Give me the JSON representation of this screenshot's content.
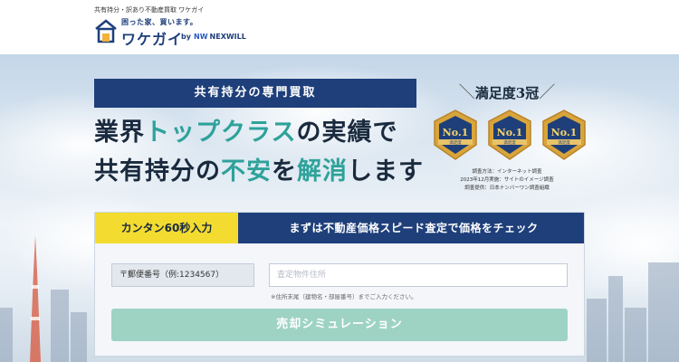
{
  "header": {
    "tagline": "共有持分・訳あり不動産買取 ワケガイ",
    "logo": {
      "catch": "困った家、買います。",
      "name": "ワケガイ",
      "by": "by",
      "partner": "NEXWILL",
      "partner_mark": "NW"
    }
  },
  "hero": {
    "badge": "共有持分の専門買取",
    "headline": {
      "line1_part1": "業界",
      "line1_accent": "トップクラス",
      "line1_part2": "の実績で",
      "line2_part1": "共有持分の",
      "line2_accent1": "不安",
      "line2_part2": "を",
      "line2_accent2": "解消",
      "line2_part3": "します"
    },
    "satisfaction": {
      "title": "満足度3冠",
      "medals": [
        {
          "rank": "No.1",
          "label": "満足度"
        },
        {
          "rank": "No.1",
          "label": "満足度"
        },
        {
          "rank": "No.1",
          "label": "満足度"
        }
      ],
      "survey_lines": [
        "調査方法：インターネット調査",
        "2023年12月実施：サイトのイメージ調査",
        "調査提供：日本ナンバーワン調査組織"
      ]
    }
  },
  "form": {
    "tab_label": "カンタン60秒入力",
    "title": "まずは不動産価格スピード査定で価格をチェック",
    "zip_placeholder": "〒郵便番号（例:1234567）",
    "address_placeholder": "査定物件住所",
    "note": "※住所末尾（建物名・部屋番号）までご入力ください。",
    "submit_label": "売却シミュレーション"
  },
  "colors": {
    "navy": "#1e3f7a",
    "teal": "#2ea29a",
    "yellow": "#f3dc2f",
    "gold": "#d9a53a",
    "button": "#9ed3c4"
  }
}
